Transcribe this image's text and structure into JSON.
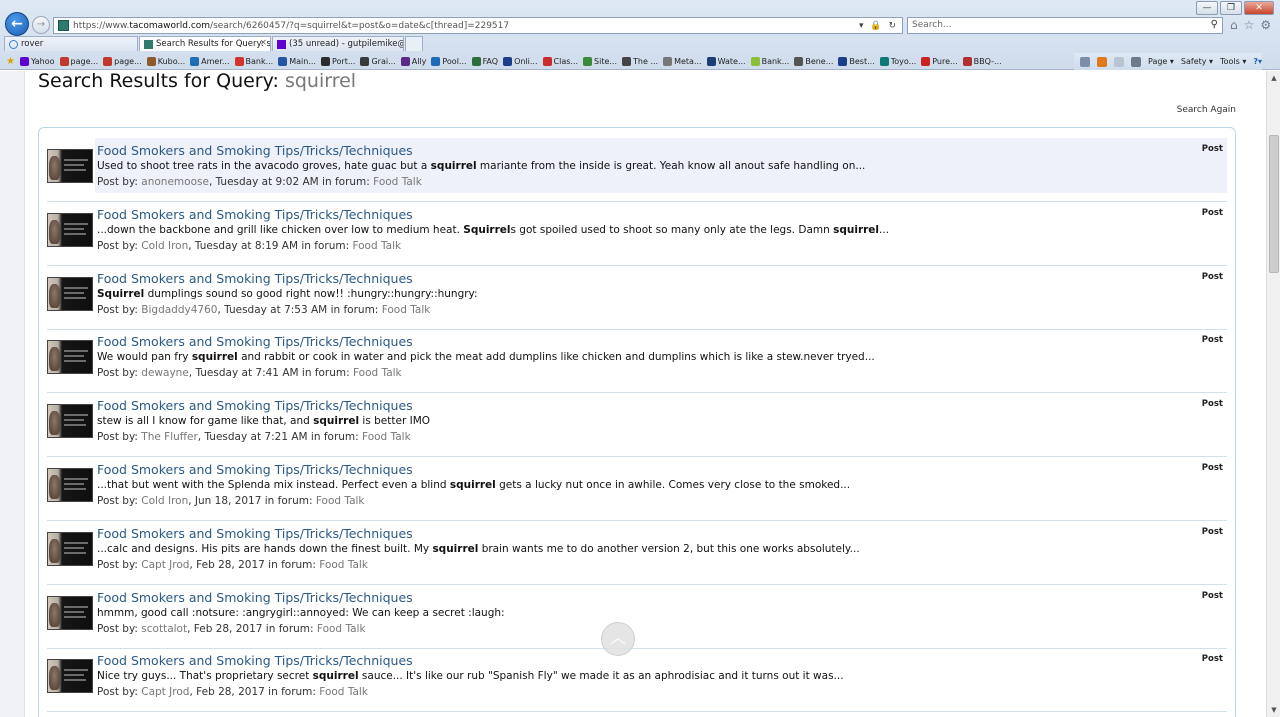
{
  "browser": {
    "window_controls": {
      "minimize": "—",
      "maximize": "❐",
      "close": "✕"
    },
    "url_host": "https://www.",
    "url_domain": "tacomaworld.com",
    "url_path": "/search/6260457/?q=squirrel&t=post&o=date&c[thread]=229517",
    "address_tools": "▾ 🔒 ↻",
    "search_placeholder": "Search...",
    "tabs": [
      {
        "label": "rover"
      },
      {
        "label": "Search Results for Query: s..."
      },
      {
        "label": "(35 unread) - gutpilemike@ya..."
      }
    ],
    "favorites": [
      {
        "label": "Yahoo",
        "color": "#5f01d1"
      },
      {
        "label": "page...",
        "color": "#c0392b"
      },
      {
        "label": "page...",
        "color": "#c0392b"
      },
      {
        "label": "Kubo...",
        "color": "#8e5a2b"
      },
      {
        "label": "Amer...",
        "color": "#1f6fb2"
      },
      {
        "label": "Bank...",
        "color": "#d0342c"
      },
      {
        "label": "Main...",
        "color": "#2456a4"
      },
      {
        "label": "Port...",
        "color": "#2d2d2d"
      },
      {
        "label": "Grai...",
        "color": "#3a3a3a"
      },
      {
        "label": "Ally",
        "color": "#5b2a86"
      },
      {
        "label": "Pool...",
        "color": "#1e6bb8"
      },
      {
        "label": "FAQ",
        "color": "#2a6f3c"
      },
      {
        "label": "Onli...",
        "color": "#1b3f8b"
      },
      {
        "label": "Clas...",
        "color": "#cc2b2b"
      },
      {
        "label": "Site...",
        "color": "#3a8a3a"
      },
      {
        "label": "The ...",
        "color": "#444444"
      },
      {
        "label": "Meta...",
        "color": "#777777"
      },
      {
        "label": "Wate...",
        "color": "#1d3d75"
      },
      {
        "label": "Bank...",
        "color": "#8bbf3a"
      },
      {
        "label": "Bene...",
        "color": "#555555"
      },
      {
        "label": "Best...",
        "color": "#1b3f8b"
      },
      {
        "label": "Toyo...",
        "color": "#0f7a75"
      },
      {
        "label": "Pure...",
        "color": "#cc2222"
      },
      {
        "label": "BBQ-...",
        "color": "#b03030"
      }
    ],
    "command_bar": {
      "page": "Page ▾",
      "safety": "Safety ▾",
      "tools": "Tools ▾"
    }
  },
  "page": {
    "title_prefix": "Search Results for Query:",
    "query": "squirrel",
    "search_again": "Search Again",
    "meta_prefix": "Post by: ",
    "meta_forum_prefix": " in forum: ",
    "results": [
      {
        "title": "Food Smokers and Smoking Tips/Tricks/Techniques",
        "snippet_parts": [
          "Used to shoot tree rats in the avacodo groves, hate guac but a ",
          "squirrel",
          " mariante from the inside is great. Yeah know all anout safe handling on...",
          "",
          ""
        ],
        "user": "anonemoose",
        "when": ", Tuesday at 9:02 AM",
        "forum": "Food Talk",
        "type": "Post",
        "highlight": true
      },
      {
        "title": "Food Smokers and Smoking Tips/Tricks/Techniques",
        "snippet_parts": [
          "...down the backbone and grill like chicken over low to medium heat. ",
          "Squirrel",
          "s got spoiled used to shoot so many only ate the legs. Damn ",
          "squirrel",
          "..."
        ],
        "user": "Cold Iron",
        "when": ", Tuesday at 8:19 AM",
        "forum": "Food Talk",
        "type": "Post"
      },
      {
        "title": "Food Smokers and Smoking Tips/Tricks/Techniques",
        "snippet_parts": [
          "",
          "Squirrel",
          " dumplings sound so good right now!! :hungry::hungry::hungry:",
          "",
          ""
        ],
        "user": "Bigdaddy4760",
        "when": ", Tuesday at 7:53 AM",
        "forum": "Food Talk",
        "type": "Post"
      },
      {
        "title": "Food Smokers and Smoking Tips/Tricks/Techniques",
        "snippet_parts": [
          "We would pan fry ",
          "squirrel",
          " and rabbit or cook in water and pick the meat add dumplins like chicken and dumplins which is like a stew.never tryed...",
          "",
          ""
        ],
        "user": "dewayne",
        "when": ", Tuesday at 7:41 AM",
        "forum": "Food Talk",
        "type": "Post"
      },
      {
        "title": "Food Smokers and Smoking Tips/Tricks/Techniques",
        "snippet_parts": [
          "stew is all I know for game like that, and ",
          "squirrel",
          " is better IMO",
          "",
          ""
        ],
        "user": "The Fluffer",
        "when": ", Tuesday at 7:21 AM",
        "forum": "Food Talk",
        "type": "Post"
      },
      {
        "title": "Food Smokers and Smoking Tips/Tricks/Techniques",
        "snippet_parts": [
          "...that but went with the Splenda mix instead. Perfect even a blind ",
          "squirrel",
          " gets a lucky nut once in awhile. Comes very close to the smoked...",
          "",
          ""
        ],
        "user": "Cold Iron",
        "when": ", Jun 18, 2017",
        "forum": "Food Talk",
        "type": "Post"
      },
      {
        "title": "Food Smokers and Smoking Tips/Tricks/Techniques",
        "snippet_parts": [
          "...calc and designs. His pits are hands down the finest built. My ",
          "squirrel",
          " brain wants me to do another version 2, but this one works absolutely...",
          "",
          ""
        ],
        "user": "Capt Jrod",
        "when": ", Feb 28, 2017",
        "forum": "Food Talk",
        "type": "Post"
      },
      {
        "title": "Food Smokers and Smoking Tips/Tricks/Techniques",
        "snippet_parts": [
          "hmmm, good call :notsure: :angrygirl::annoyed: We can keep a secret :laugh:",
          "",
          "",
          "",
          ""
        ],
        "user": "scottalot",
        "when": ", Feb 28, 2017",
        "forum": "Food Talk",
        "type": "Post"
      },
      {
        "title": "Food Smokers and Smoking Tips/Tricks/Techniques",
        "snippet_parts": [
          "Nice try guys... That's proprietary secret ",
          "squirrel",
          " sauce... It's like our rub \"Spanish Fly\" we made it as an aphrodisiac and it turns out it was...",
          "",
          ""
        ],
        "user": "Capt Jrod",
        "when": ", Feb 28, 2017",
        "forum": "Food Talk",
        "type": "Post"
      }
    ]
  }
}
